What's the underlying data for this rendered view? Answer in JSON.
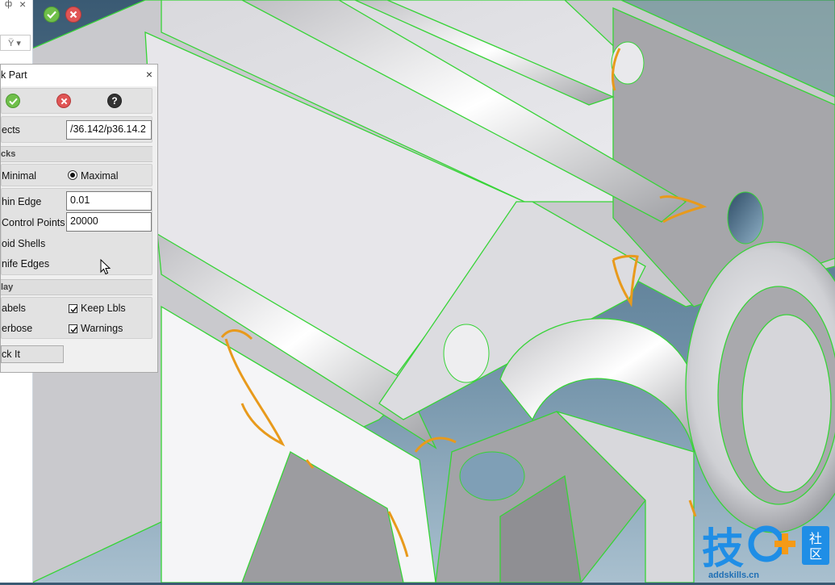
{
  "toolbar": {
    "ok_icon": "check-icon",
    "cancel_icon": "cross-icon"
  },
  "left_strip": {
    "pin_glyph": "ф",
    "close_glyph": "×",
    "filter_glyph": "Ÿ ▾"
  },
  "dialog": {
    "title": "k Part",
    "close_glyph": "×",
    "objects_label": "ects",
    "objects_value": "/36.142/p36.14.2",
    "section_checks": "cks",
    "radio_minimal": "Minimal",
    "radio_maximal": "Maximal",
    "selected_mode": "Maximal",
    "min_edge_label": "hin Edge",
    "min_edge_value": "0.01",
    "control_points_label": "Control Points",
    "control_points_value": "20000",
    "void_shells_label": "oid Shells",
    "knife_edges_label": "nife Edges",
    "section_display": "lay",
    "labels_label": "abels",
    "keep_lbls_label": "Keep Lbls",
    "keep_lbls_checked": true,
    "verbose_label": "erbose",
    "warnings_label": "Warnings",
    "warnings_checked": true,
    "apply_label": "ck It"
  },
  "watermark": {
    "main": "技",
    "badge": "社区",
    "url": "addskills.cn"
  },
  "colors": {
    "sky": "#3a5a73",
    "part": "#e6e6e8",
    "edge": "#37d437",
    "highlight": "#e89a1c",
    "ok": "#6fbf4a",
    "cancel": "#e05555"
  }
}
